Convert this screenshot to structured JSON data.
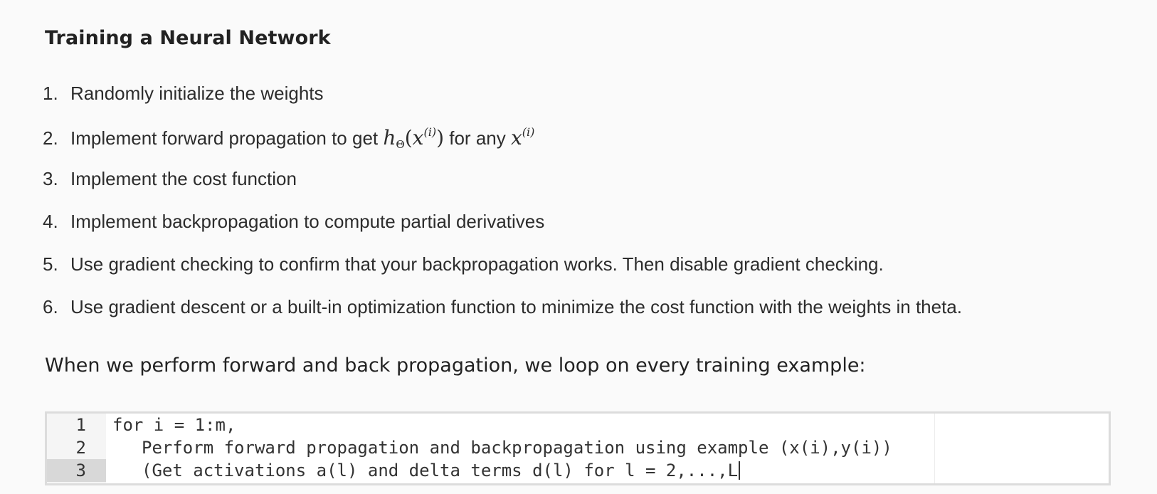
{
  "heading": "Training a Neural Network",
  "steps": [
    {
      "num": "1.",
      "text": "Randomly initialize the weights"
    },
    {
      "num": "2.",
      "text_before": "Implement forward propagation to get",
      "math_h": "h",
      "math_h_sub": "Θ",
      "math_x": "x",
      "math_x_sup": "(i)",
      "text_mid": "for any",
      "math_x2": "x",
      "math_x2_sup": "(i)"
    },
    {
      "num": "3.",
      "text": "Implement the cost function"
    },
    {
      "num": "4.",
      "text": "Implement backpropagation to compute partial derivatives"
    },
    {
      "num": "5.",
      "text": "Use gradient checking to confirm that your backpropagation works. Then disable gradient checking."
    },
    {
      "num": "6.",
      "text": "Use gradient descent or a built-in optimization function to minimize the cost function with the weights in theta."
    }
  ],
  "intro": "When we perform forward and back propagation, we loop on every training example:",
  "code": {
    "line_numbers": [
      "1",
      "2",
      "3"
    ],
    "lines": [
      "for i = 1:m,",
      "Perform forward propagation and backpropagation using example (x(i),y(i))",
      "(Get activations a(l) and delta terms d(l) for l = 2,...,L"
    ],
    "active_line": 3
  }
}
